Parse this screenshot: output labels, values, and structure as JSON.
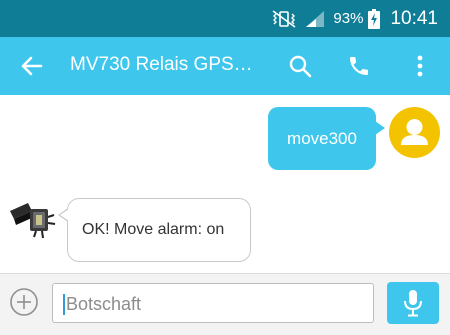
{
  "status_bar": {
    "battery_percent": "93%",
    "time": "10:41",
    "icons": [
      "vibrate-icon",
      "signal-icon",
      "battery-charging-icon"
    ]
  },
  "app_bar": {
    "title": "MV730 Relais GPS…",
    "icons": [
      "back-arrow-icon",
      "search-icon",
      "phone-icon",
      "more-vert-icon"
    ]
  },
  "messages": [
    {
      "direction": "outgoing",
      "text": "move300"
    },
    {
      "direction": "incoming",
      "text": "OK! Move alarm: on"
    }
  ],
  "composer": {
    "placeholder": "Botschaft",
    "value": "",
    "icons": [
      "add-circle-icon",
      "mic-icon"
    ]
  },
  "colors": {
    "status_bar": "#0f7d96",
    "accent": "#3fc6ec",
    "avatar": "#f3c300",
    "incoming_bubble_border": "#c9c9c9"
  }
}
